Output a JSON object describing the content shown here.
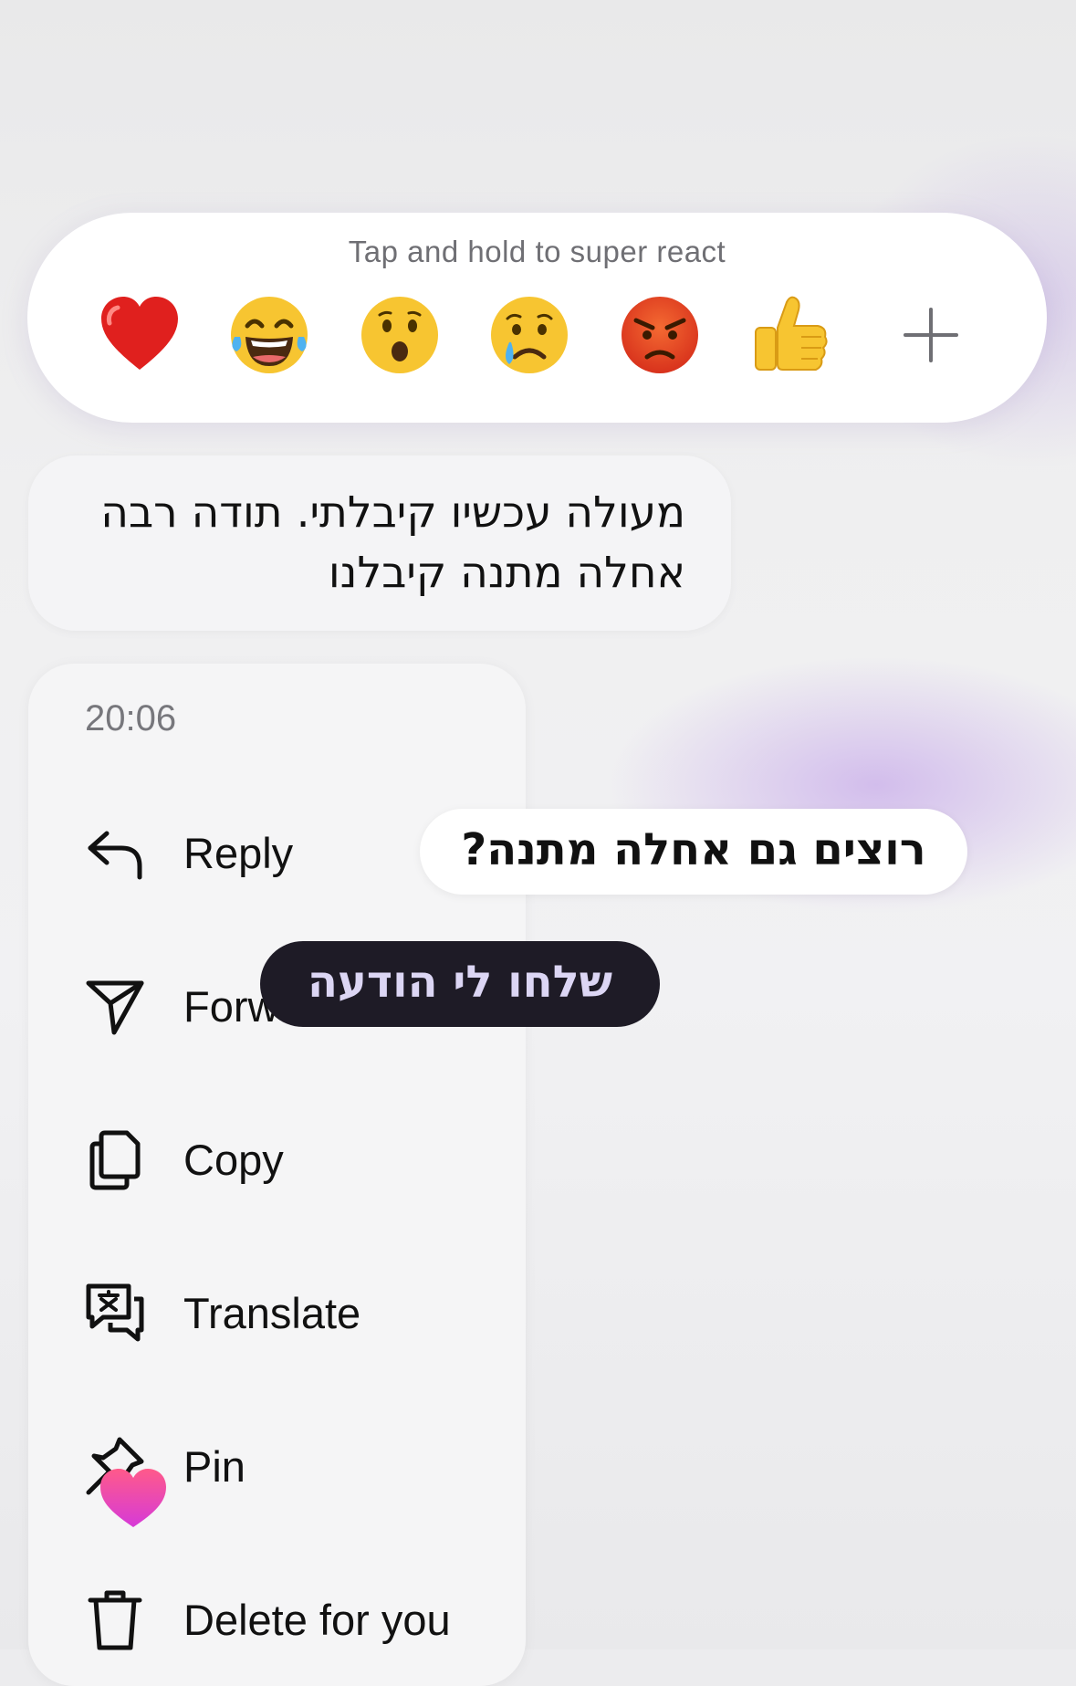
{
  "reaction_bar": {
    "hint": "Tap and hold to super react",
    "reactions": [
      {
        "icon": "red-heart-emoji",
        "glyph": "❤️"
      },
      {
        "icon": "tears-of-joy-emoji",
        "glyph": "😂"
      },
      {
        "icon": "surprised-face-emoji",
        "glyph": "😮"
      },
      {
        "icon": "crying-face-emoji",
        "glyph": "😢"
      },
      {
        "icon": "angry-face-emoji",
        "glyph": "😡"
      },
      {
        "icon": "thumbs-up-emoji",
        "glyph": "👍"
      }
    ],
    "more_icon": "plus-icon"
  },
  "message": {
    "lines": [
      "מעולה עכשיו קיבלתי. תודה רבה",
      "אחלה מתנה קיבלנו"
    ]
  },
  "menu": {
    "time": "20:06",
    "items": [
      {
        "label": "Reply",
        "icon": "reply-arrow-icon"
      },
      {
        "label": "Forward",
        "icon": "paper-plane-icon"
      },
      {
        "label": "Copy",
        "icon": "copy-icon"
      },
      {
        "label": "Translate",
        "icon": "translate-icon"
      },
      {
        "label": "Pin",
        "icon": "pin-icon"
      },
      {
        "label": "Delete for you",
        "icon": "trash-icon"
      }
    ]
  },
  "overlays": {
    "question": "רוצים גם אחלה מתנה?",
    "cta": "שלחו לי הודעה",
    "heart_icon": "pink-heart-sticker",
    "colors": {
      "cta_bg": "#1e1b26",
      "cta_text": "#dcd6f4",
      "heart_top": "#ff5a8a",
      "heart_bottom": "#d63ad8"
    }
  }
}
